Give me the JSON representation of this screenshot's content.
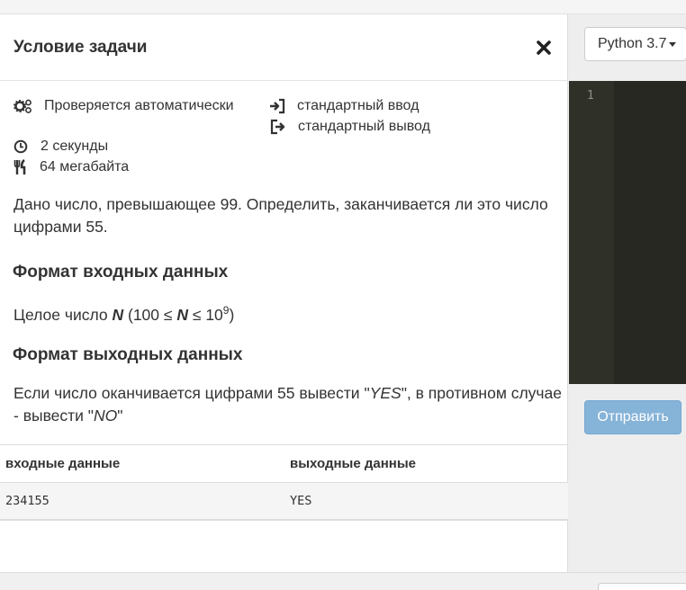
{
  "problem": {
    "title": "Условие задачи",
    "checker": "Проверяется автоматически",
    "input_type": "стандартный ввод",
    "output_type": "стандартный вывод",
    "time_limit": "2 секунды",
    "memory_limit": "64 мегабайта",
    "statement": "Дано число, превышающее 99. Определить, заканчивается ли это число цифрами 55.",
    "input_format_title": "Формат входных данных",
    "input_format": {
      "prefix": "Целое число ",
      "var": "N",
      "lo": " (100 ≤ ",
      "mid": " ≤ 10",
      "exp": "9",
      "hi": ")"
    },
    "output_format_title": "Формат выходных данных",
    "output_format": {
      "part1": "Если число оканчивается цифрами 55 вывести \"",
      "yes": "YES",
      "part2": "\", в противном случае - вывести \"",
      "no": "NO",
      "part3": "\""
    }
  },
  "samples": {
    "headers": [
      "входные данные",
      "выходные данные"
    ],
    "rows": [
      {
        "input": "234155",
        "output": "YES"
      }
    ]
  },
  "editor": {
    "language": "Python 3.7",
    "line_number": "1",
    "submit_label": "Отправить"
  }
}
